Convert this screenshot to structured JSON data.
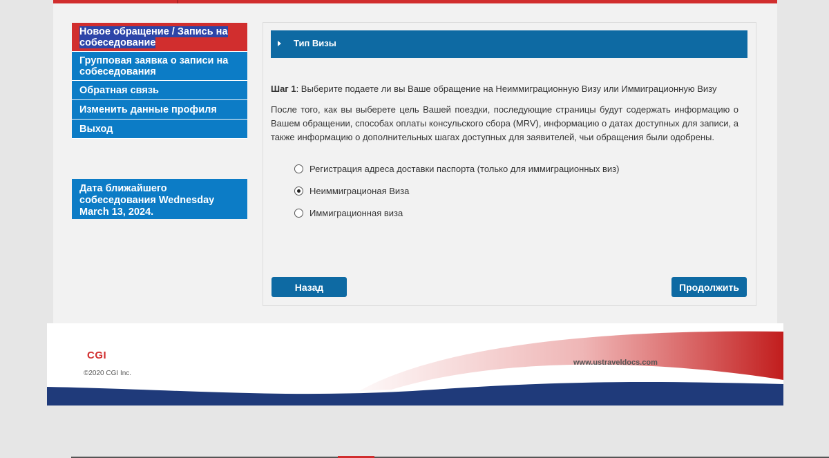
{
  "sidebar": {
    "items": [
      {
        "label": "Новое обращение / Запись на собеседование",
        "active": true
      },
      {
        "label": "Групповая заявка о записи на собеседования",
        "active": false
      },
      {
        "label": "Обратная связь",
        "active": false
      },
      {
        "label": "Изменить данные профиля",
        "active": false
      },
      {
        "label": "Выход",
        "active": false
      }
    ],
    "next_date": "Дата ближайшего собеседования Wednesday March 13, 2024."
  },
  "panel": {
    "header_title": "Тип Визы",
    "step_label": "Шаг 1",
    "step_text": ": Выберите подаете ли вы Ваше обращение на Неиммиграционную Визу или Иммиграционную Визу",
    "description": "После того, как вы выберете цель Вашей поездки, последующие страницы будут содержать информацию о Вашем обращении, способах оплаты консульского сбора (MRV), информацию о датах доступных для записи, а также информацию о дополнительных шагах доступных для заявителей, чьи обращения были одобрены.",
    "options": [
      {
        "label": "Регистрация адреса доставки паспорта (только для иммиграционных виз)",
        "checked": false
      },
      {
        "label": "Неиммиграционая Виза",
        "checked": true
      },
      {
        "label": "Иммиграционная виза",
        "checked": false
      }
    ],
    "back_label": "Назад",
    "continue_label": "Продолжить"
  },
  "footer": {
    "logo": "CGI",
    "copyright": "©2020 CGI Inc.",
    "site": "www.ustraveldocs.com"
  },
  "colors": {
    "accent_blue": "#0c7cc6",
    "header_blue": "#0e6aa3",
    "brand_red": "#d12e2e",
    "navy": "#1f3a7a"
  }
}
